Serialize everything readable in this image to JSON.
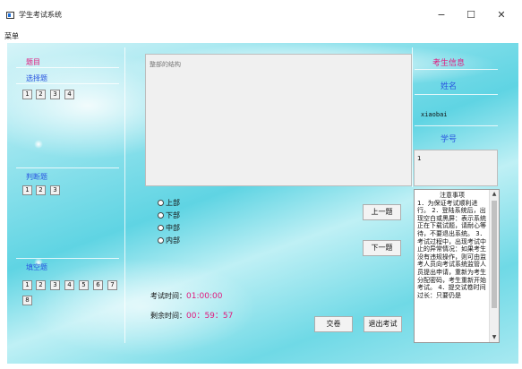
{
  "window": {
    "title": "学生考试系统",
    "minimize": "−",
    "maximize": "☐",
    "close": "✕"
  },
  "menu": {
    "label": "菜单"
  },
  "left": {
    "title": "题目",
    "choice": {
      "label": "选择题",
      "buttons": [
        "1",
        "2",
        "3",
        "4"
      ]
    },
    "judge": {
      "label": "判断题",
      "buttons": [
        "1",
        "2",
        "3"
      ]
    },
    "fill": {
      "label": "填空题",
      "buttons": [
        "1",
        "2",
        "3",
        "4",
        "5",
        "6",
        "7",
        "8"
      ]
    }
  },
  "question": {
    "placeholder": "整部的结构",
    "options": [
      "上部",
      "下部",
      "中部",
      "内部"
    ],
    "prev_label": "上一题",
    "next_label": "下一题"
  },
  "timer": {
    "exam_label": "考试时间：",
    "exam_value": "01:00:00",
    "remain_label": "剩余时间：",
    "remain_value": "00：59：57"
  },
  "actions": {
    "submit_label": "交卷",
    "exit_label": "退出考试"
  },
  "student": {
    "title": "考生信息",
    "name_label": "姓名",
    "name_value": "xiaobai",
    "id_label": "学号",
    "id_value": "1"
  },
  "notes": {
    "heading": "注意事项",
    "body": "1．为保证考试顺利进行。\n2．登陆系统后，出现空白或黑屏：表示系统正在下载试题，请耐心等待，不要退出系统。 3．考试过程中，出现考试中止的异常情况：如果考生没有违规操作，则可由监考人员向考试系统监管人员提出申请，重新为考生分配密码，考生重新开始考试。 4．提交试卷时间过长：只要仍是"
  },
  "colors": {
    "accent_pink": "#e0197d",
    "accent_blue": "#2a56e0",
    "background_cyan": "#5fd4e3"
  }
}
